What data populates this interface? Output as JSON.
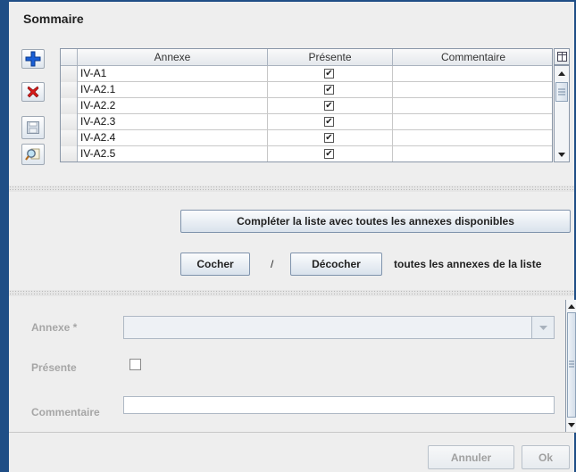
{
  "panel": {
    "title": "Sommaire"
  },
  "toolbar": {
    "add": {
      "icon": "add-icon",
      "color": "#1a5fd6"
    },
    "delete": {
      "icon": "delete-icon",
      "color": "#d61a1a"
    },
    "save": {
      "icon": "save-icon"
    },
    "search": {
      "icon": "search-icon"
    }
  },
  "table": {
    "columns": [
      "Annexe",
      "Présente",
      "Commentaire"
    ],
    "rows": [
      {
        "annexe": "IV-A1",
        "presente": true,
        "commentaire": ""
      },
      {
        "annexe": "IV-A2.1",
        "presente": true,
        "commentaire": ""
      },
      {
        "annexe": "IV-A2.2",
        "presente": true,
        "commentaire": ""
      },
      {
        "annexe": "IV-A2.3",
        "presente": true,
        "commentaire": ""
      },
      {
        "annexe": "IV-A2.4",
        "presente": true,
        "commentaire": ""
      },
      {
        "annexe": "IV-A2.5",
        "presente": true,
        "commentaire": ""
      }
    ],
    "checkmark": "✔"
  },
  "actions": {
    "complete_list": "Compléter la liste avec toutes les annexes disponibles",
    "check": "Cocher",
    "separator": "/",
    "uncheck": "Décocher",
    "suffix": "toutes les annexes de la liste"
  },
  "form": {
    "annexe_label": "Annexe *",
    "annexe_value": "",
    "presente_label": "Présente",
    "presente_checked": false,
    "commentaire_label": "Commentaire",
    "commentaire_value": ""
  },
  "footer": {
    "cancel": "Annuler",
    "ok": "Ok"
  }
}
